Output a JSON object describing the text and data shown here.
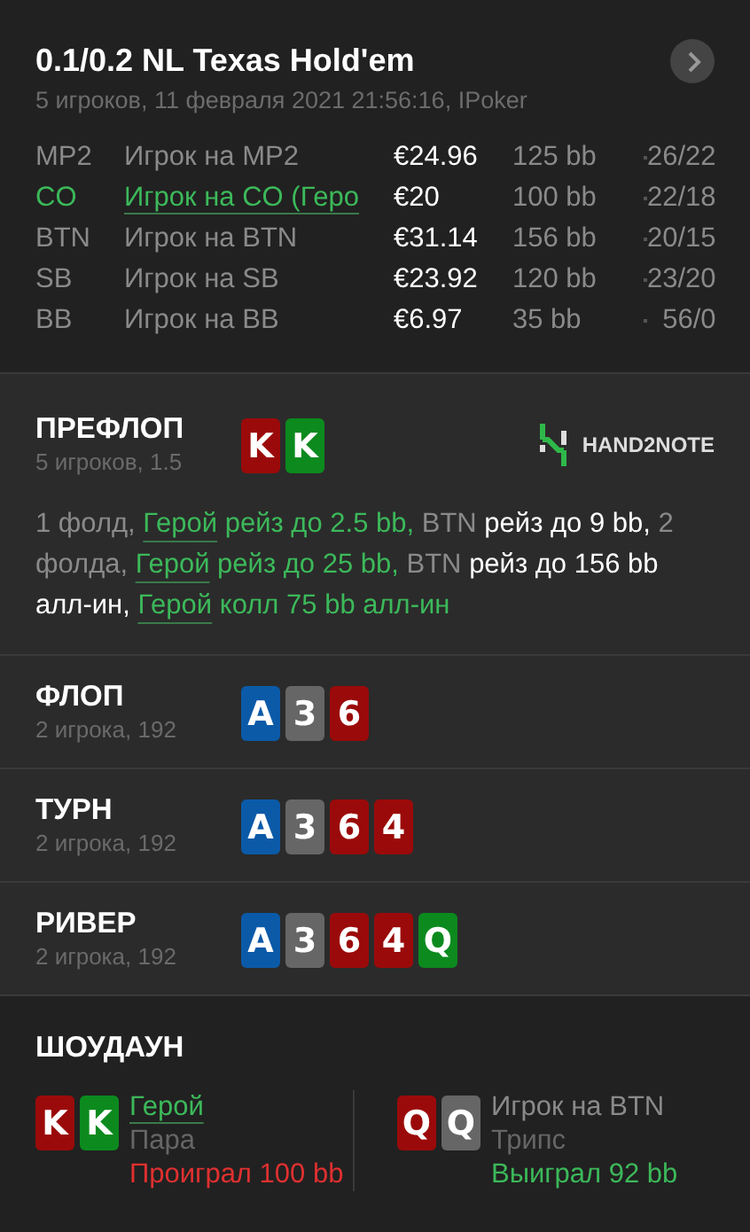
{
  "header": {
    "title": "0.1/0.2 NL Texas Hold'em",
    "subtitle": "5 игроков, 11 февраля 2021 21:56:16, IPoker"
  },
  "players": [
    {
      "position": "MP2",
      "name": "Игрок на MP2",
      "stack": "€24.96",
      "bb": "125 bb",
      "stats": "26/22",
      "hero": false
    },
    {
      "position": "CO",
      "name": "Игрок на CO (Геро",
      "stack": "€20",
      "bb": "100 bb",
      "stats": "22/18",
      "hero": true
    },
    {
      "position": "BTN",
      "name": "Игрок на BTN",
      "stack": "€31.14",
      "bb": "156 bb",
      "stats": "20/15",
      "hero": false
    },
    {
      "position": "SB",
      "name": "Игрок на SB",
      "stack": "€23.92",
      "bb": "120 bb",
      "stats": "23/20",
      "hero": false
    },
    {
      "position": "BB",
      "name": "Игрок на BB",
      "stack": "€6.97",
      "bb": "35 bb",
      "stats": "56/0",
      "hero": false
    }
  ],
  "preflop": {
    "title": "ПРЕФЛОП",
    "subtitle": "5 игроков, 1.5",
    "logo": "HAND2NOTE",
    "cards": [
      {
        "rank": "K",
        "color": "#9b0a0a"
      },
      {
        "rank": "K",
        "color": "#0c8a1e"
      }
    ],
    "actions": [
      {
        "kind": "plain",
        "text": "1 фолд, "
      },
      {
        "kind": "hero",
        "text": "Герой"
      },
      {
        "kind": "hero_action",
        "text": " рейз до 2.5 bb, "
      },
      {
        "kind": "plain",
        "text": "BTN "
      },
      {
        "kind": "action",
        "text": "рейз до 9 bb, "
      },
      {
        "kind": "plain",
        "text": "2 фолда, "
      },
      {
        "kind": "hero",
        "text": "Герой"
      },
      {
        "kind": "hero_action",
        "text": " рейз до 25 bb, "
      },
      {
        "kind": "plain",
        "text": "BTN "
      },
      {
        "kind": "action",
        "text": "рейз до 156 bb алл-ин, "
      },
      {
        "kind": "hero",
        "text": "Герой"
      },
      {
        "kind": "hero_action",
        "text": " колл 75 bb алл-ин"
      }
    ]
  },
  "streets": [
    {
      "title": "ФЛОП",
      "subtitle": "2 игрока, 192",
      "cards": [
        {
          "rank": "A",
          "color": "#0b5aa8"
        },
        {
          "rank": "3",
          "color": "#666666"
        },
        {
          "rank": "6",
          "color": "#9b0a0a"
        }
      ]
    },
    {
      "title": "ТУРН",
      "subtitle": "2 игрока, 192",
      "cards": [
        {
          "rank": "A",
          "color": "#0b5aa8"
        },
        {
          "rank": "3",
          "color": "#666666"
        },
        {
          "rank": "6",
          "color": "#9b0a0a"
        },
        {
          "rank": "4",
          "color": "#9b0a0a"
        }
      ]
    },
    {
      "title": "РИВЕР",
      "subtitle": "2 игрока, 192",
      "cards": [
        {
          "rank": "A",
          "color": "#0b5aa8"
        },
        {
          "rank": "3",
          "color": "#666666"
        },
        {
          "rank": "6",
          "color": "#9b0a0a"
        },
        {
          "rank": "4",
          "color": "#9b0a0a"
        },
        {
          "rank": "Q",
          "color": "#0c8a1e"
        }
      ]
    }
  ],
  "showdown": {
    "title": "ШОУДАУН",
    "hands": [
      {
        "name": "Герой",
        "hero": true,
        "combo": "Пара",
        "result": "Проиграл 100 bb",
        "won": false,
        "cards": [
          {
            "rank": "K",
            "color": "#9b0a0a"
          },
          {
            "rank": "K",
            "color": "#0c8a1e"
          }
        ]
      },
      {
        "name": "Игрок на BTN",
        "hero": false,
        "combo": "Трипс",
        "result": "Выиграл 92 bb",
        "won": true,
        "cards": [
          {
            "rank": "Q",
            "color": "#9b0a0a"
          },
          {
            "rank": "Q",
            "color": "#666666"
          }
        ]
      }
    ]
  }
}
